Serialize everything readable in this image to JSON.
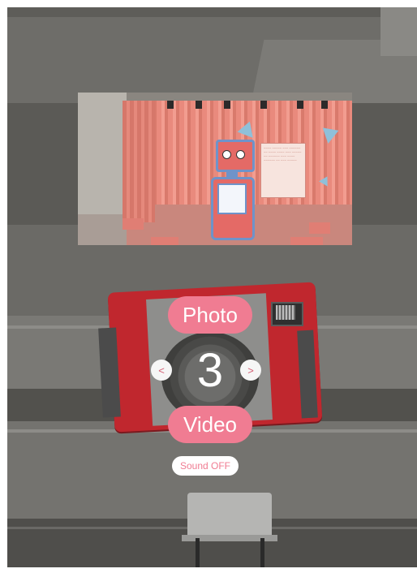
{
  "camera": {
    "photo_label": "Photo",
    "video_label": "Video",
    "countdown": "3",
    "prev_label": "<",
    "next_label": ">",
    "sound_label": "Sound OFF",
    "accent_color": "#f07c92",
    "body_color": "#c0272e"
  },
  "preview": {
    "icons": [
      "robot-avatar",
      "paper-plane-icon",
      "poster"
    ]
  }
}
